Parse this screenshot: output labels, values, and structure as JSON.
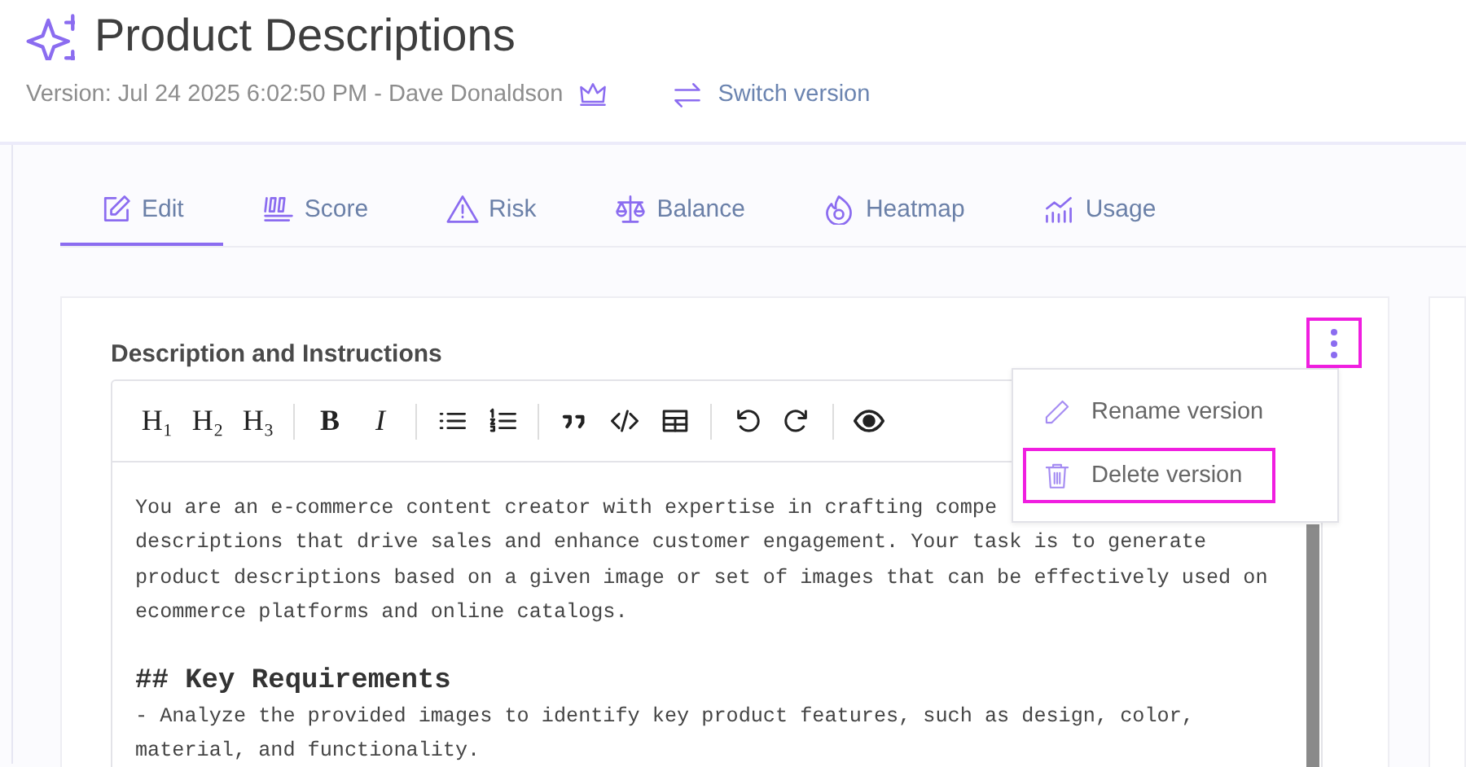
{
  "header": {
    "title": "Product Descriptions",
    "version": "Version: Jul 24 2025 6:02:50 PM - Dave Donaldson",
    "switch_link": "Switch version"
  },
  "tabs": [
    {
      "kind": "edit",
      "label": "Edit",
      "selected": true
    },
    {
      "kind": "score",
      "label": "Score",
      "selected": false
    },
    {
      "kind": "risk",
      "label": "Risk",
      "selected": false
    },
    {
      "kind": "balance",
      "label": "Balance",
      "selected": false
    },
    {
      "kind": "heatmap",
      "label": "Heatmap",
      "selected": false
    },
    {
      "kind": "usage",
      "label": "Usage",
      "selected": false
    }
  ],
  "card": {
    "heading": "Description and Instructions",
    "more_button": {
      "highlighted": true
    },
    "toolbar": [
      {
        "kind": "text",
        "label": "H₁"
      },
      {
        "kind": "text",
        "label": "H₂"
      },
      {
        "kind": "text",
        "label": "H₃"
      },
      {
        "kind": "sep"
      },
      {
        "kind": "bold",
        "label": "B"
      },
      {
        "kind": "italic",
        "label": "I"
      },
      {
        "kind": "sep"
      },
      {
        "kind": "bullets"
      },
      {
        "kind": "numbers"
      },
      {
        "kind": "sep"
      },
      {
        "kind": "quote"
      },
      {
        "kind": "code"
      },
      {
        "kind": "table"
      },
      {
        "kind": "sep"
      },
      {
        "kind": "undo"
      },
      {
        "kind": "redo"
      },
      {
        "kind": "sep"
      },
      {
        "kind": "preview"
      }
    ],
    "lines": [
      {
        "kind": "text",
        "text": "You are an e-commerce content creator with expertise in crafting compe"
      },
      {
        "kind": "text",
        "text": "descriptions that drive sales and enhance customer engagement. Your task is to generate"
      },
      {
        "kind": "text",
        "text": "product descriptions based on a given image or set of images that can be effectively used on"
      },
      {
        "kind": "text",
        "text": "ecommerce platforms and online catalogs."
      },
      {
        "kind": "blank"
      },
      {
        "kind": "heading",
        "text": "## Key Requirements"
      },
      {
        "kind": "text",
        "text": "- Analyze the provided images to identify key product features, such as design, color,"
      },
      {
        "kind": "text",
        "text": "material, and functionality."
      }
    ]
  },
  "menu": [
    {
      "kind": "rename",
      "label": "Rename version",
      "highlighted": false
    },
    {
      "kind": "delete",
      "label": "Delete version",
      "highlighted": true
    }
  ]
}
